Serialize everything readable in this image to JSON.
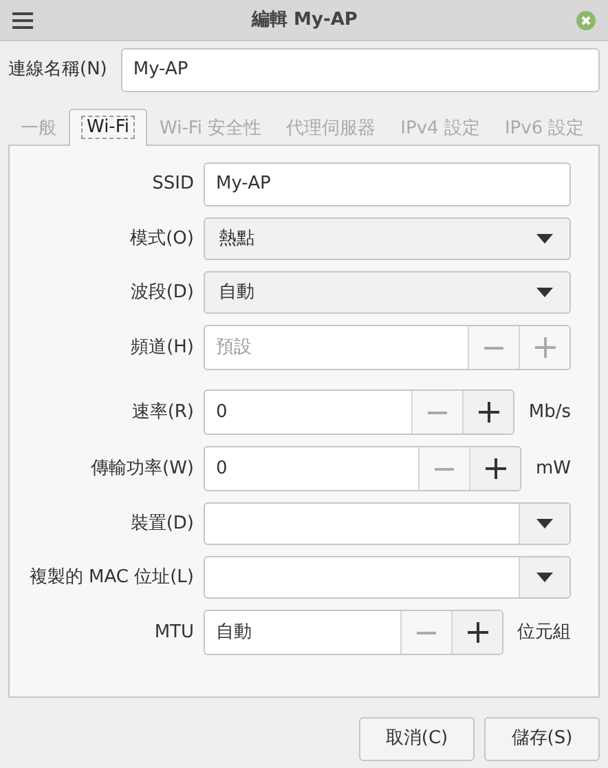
{
  "window": {
    "title": "編輯 My-AP"
  },
  "connection_name": {
    "label": "連線名稱(N)",
    "value": "My-AP"
  },
  "tabs": [
    {
      "label": "一般",
      "selected": false
    },
    {
      "label": "Wi-Fi",
      "selected": true
    },
    {
      "label": "Wi-Fi 安全性",
      "selected": false
    },
    {
      "label": "代理伺服器",
      "selected": false
    },
    {
      "label": "IPv4 設定",
      "selected": false
    },
    {
      "label": "IPv6 設定",
      "selected": false
    }
  ],
  "fields": [
    {
      "kind": "text",
      "label": "SSID",
      "value": "My-AP"
    },
    {
      "kind": "combo",
      "label": "模式(O)",
      "value": "熱點"
    },
    {
      "kind": "combo",
      "label": "波段(D)",
      "value": "自動"
    },
    {
      "kind": "spin",
      "label": "頻道(H)",
      "placeholder": "預設",
      "disabled": true,
      "decrement_enabled": false,
      "increment_enabled": false
    },
    {
      "kind": "spin",
      "label": "速率(R)",
      "value": "0",
      "unit": "Mb/s",
      "disabled": false,
      "decrement_enabled": false,
      "increment_enabled": true
    },
    {
      "kind": "spin",
      "label": "傳輸功率(W)",
      "value": "0",
      "unit": "mW",
      "disabled": false,
      "decrement_enabled": false,
      "increment_enabled": true
    },
    {
      "kind": "combo-entry",
      "label": "裝置(D)"
    },
    {
      "kind": "combo-entry",
      "label": "複製的 MAC 位址(L)"
    },
    {
      "kind": "spin",
      "label": "MTU",
      "value": "自動",
      "unit": "位元組",
      "disabled": false,
      "decrement_enabled": false,
      "increment_enabled": true
    }
  ],
  "buttons": [
    {
      "label": "取消(C)"
    },
    {
      "label": "儲存(S)"
    }
  ]
}
